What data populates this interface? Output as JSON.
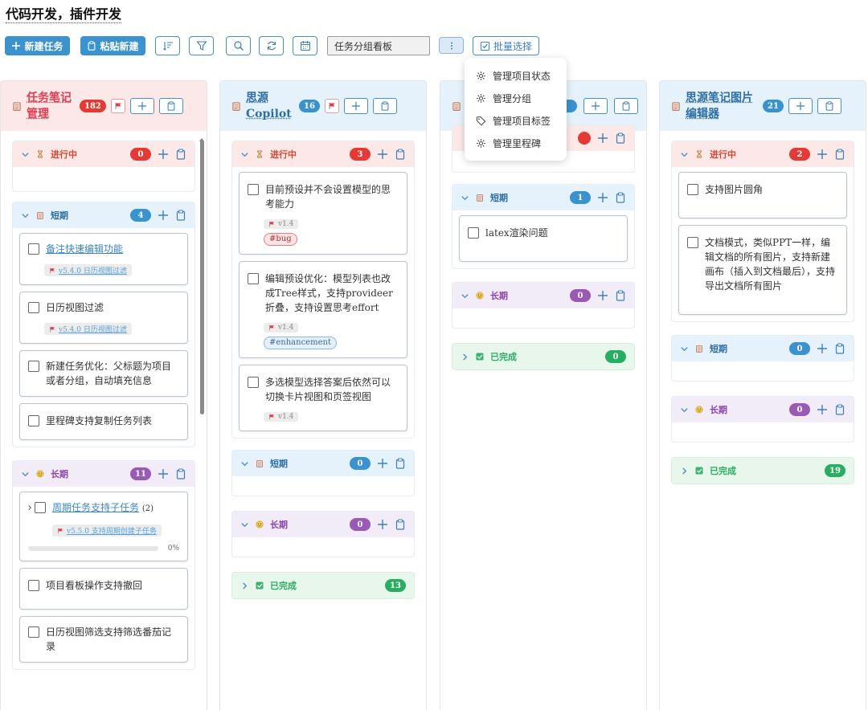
{
  "page_title": "代码开发，插件开发",
  "toolbar": {
    "new_task": "新建任务",
    "paste_new": "粘贴新建",
    "view_select": "任务分组看板",
    "batch_select": "批量选择"
  },
  "menu": {
    "items": [
      "管理项目状态",
      "管理分组",
      "管理项目标签",
      "管理里程碑"
    ]
  },
  "colors": {
    "primary": "#3a92cf",
    "in_progress_bg": "#fde8e8",
    "short_bg": "#e6f2fb",
    "long_bg": "#f2ebf8",
    "done_bg": "#e8f6ec",
    "red": "#e53935",
    "blue": "#3a92cf",
    "purple": "#9b59b6",
    "green": "#27ae60"
  },
  "columns": [
    {
      "name_l1": "任务笔记",
      "name_l2": "管理",
      "count": "182",
      "groups": {
        "inprog": {
          "label": "进行中",
          "count": "0"
        },
        "short": {
          "label": "短期",
          "count": "4",
          "cards": [
            {
              "text": "备注快速编辑功能",
              "milestone": "v5.4.0 日历视图过滤"
            },
            {
              "text": "日历视图过滤",
              "milestone": "v5.4.0 日历视图过滤"
            },
            {
              "text": "新建任务优化：父标题为项目或者分组，自动填充信息"
            },
            {
              "text": "里程碑支持复制任务列表"
            }
          ]
        },
        "long": {
          "label": "长期",
          "count": "11",
          "cards": [
            {
              "text": "周期任务支持子任务",
              "sub": "(2)",
              "milestone": "v5.5.0 支持周期创建子任务",
              "progress": "0%"
            },
            {
              "text": "项目看板操作支持撤回"
            },
            {
              "text": "日历视图筛选支持筛选番茄记录"
            }
          ]
        }
      }
    },
    {
      "name_l1": "思源",
      "name_l2": "Copilot",
      "count": "16",
      "groups": {
        "inprog": {
          "label": "进行中",
          "count": "3",
          "cards": [
            {
              "text": "目前预设并不会设置模型的思考能力",
              "milestone": "v1.4",
              "tag": "#bug"
            },
            {
              "text": "编辑预设优化：模型列表也改成Tree样式，支持provideer折叠，支持设置思考effort",
              "milestone": "v1.4",
              "tag": "#enhancement"
            },
            {
              "text": "多选模型选择答案后依然可以切换卡片视图和页签视图",
              "milestone": "v1.4"
            }
          ]
        },
        "short": {
          "label": "短期",
          "count": "0"
        },
        "long": {
          "label": "长期",
          "count": "0"
        },
        "done": {
          "label": "已完成",
          "count": "13"
        }
      }
    },
    {
      "groups": {
        "short": {
          "label": "短期",
          "count": "1",
          "cards": [
            {
              "text": "latex渲染问题"
            }
          ]
        },
        "long": {
          "label": "长期",
          "count": "0"
        },
        "done": {
          "label": "已完成",
          "count": "0"
        }
      }
    },
    {
      "name_l1": "思源笔记图片",
      "name_l2": "编辑器",
      "count": "21",
      "groups": {
        "inprog": {
          "label": "进行中",
          "count": "2",
          "cards": [
            {
              "text": "支持图片圆角"
            },
            {
              "text": "文档模式，类似PPT一样，编辑文档的所有图片，支持新建画布（插入到文档最后），支持导出文档所有图片"
            }
          ]
        },
        "short": {
          "label": "短期",
          "count": "0"
        },
        "long": {
          "label": "长期",
          "count": "0"
        },
        "done": {
          "label": "已完成",
          "count": "19"
        }
      }
    }
  ]
}
